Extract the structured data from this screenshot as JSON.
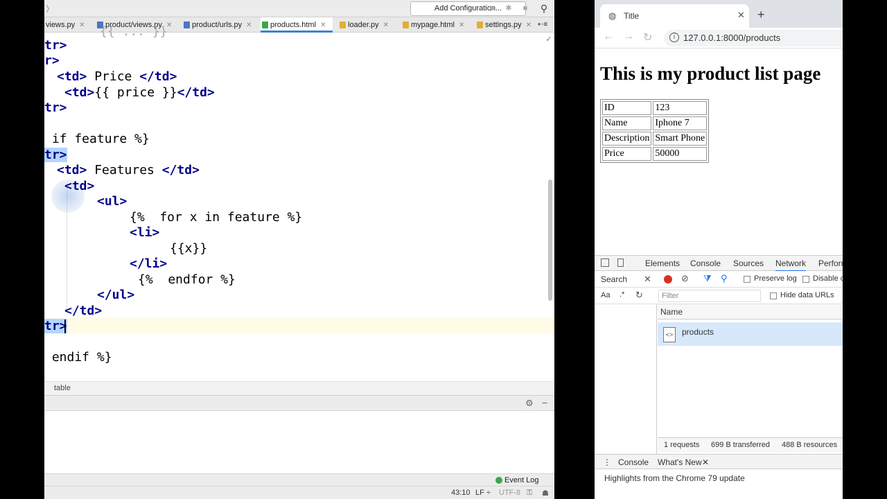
{
  "ide": {
    "add_configuration_label": "Add Configuration...",
    "tabs": [
      {
        "label": "views.py"
      },
      {
        "label": "product/views.py"
      },
      {
        "label": "product/urls.py"
      },
      {
        "label": "products.html"
      },
      {
        "label": "loader.py"
      },
      {
        "label": "mypage.html"
      },
      {
        "label": "settings.py"
      }
    ],
    "tab_overflow_label": "⇠≡",
    "editor_lines": {
      "l1": "{{ ... }}",
      "l2": "tr>",
      "l3": "r>",
      "l4_open": "<td>",
      "l4_text": " Price ",
      "l4_close": "</td>",
      "l5_open": "<td>",
      "l5_text": "{{ price }}",
      "l5_close": "</td>",
      "l6": "tr>",
      "l7": " if feature %}",
      "l8": "tr>",
      "l9_open": "<td>",
      "l9_text": " Features ",
      "l9_close": "</td>",
      "l10": "<td>",
      "l11": "<ul>",
      "l12": "{%  for x in feature %}",
      "l13": "<li>",
      "l14": "{{x}}",
      "l15": "</li>",
      "l16": "{%  endfor %}",
      "l17": "</ul>",
      "l18": "</td>",
      "l19": "tr>",
      "l20": " endif %}"
    },
    "breadcrumb": "table",
    "event_log_label": "Event Log",
    "status": {
      "position": "43:10",
      "line_separator": "LF ÷",
      "encoding": "UTF-8"
    }
  },
  "browser": {
    "tab_title": "Title",
    "url": "127.0.0.1:8000/products",
    "page": {
      "heading": "This is my product list page",
      "rows": [
        {
          "key": "ID",
          "value": "123"
        },
        {
          "key": "Name",
          "value": "Iphone 7"
        },
        {
          "key": "Description",
          "value": "Smart Phone"
        },
        {
          "key": "Price",
          "value": "50000"
        }
      ]
    },
    "devtools": {
      "tabs": [
        "Elements",
        "Console",
        "Sources",
        "Network",
        "Perform"
      ],
      "search_label": "Search",
      "preserve_log_label": "Preserve log",
      "disable_cache_label": "Disable c",
      "case_label": "Aa",
      "regex_label": ".*",
      "filter_placeholder": "Filter",
      "hide_data_urls_label": "Hide data URLs",
      "name_column": "Name",
      "request_name": "products",
      "summary": {
        "requests": "1 requests",
        "transferred": "699 B transferred",
        "resources": "488 B resources"
      },
      "drawer_tabs": [
        "Console",
        "What's New"
      ],
      "drawer_text": "Highlights from the Chrome 79 update"
    }
  },
  "colors": {
    "tag_color": "#00008b",
    "selection": "#b4d5fe",
    "active_tab_underline": "#3b82d6",
    "record": "#d93025"
  }
}
